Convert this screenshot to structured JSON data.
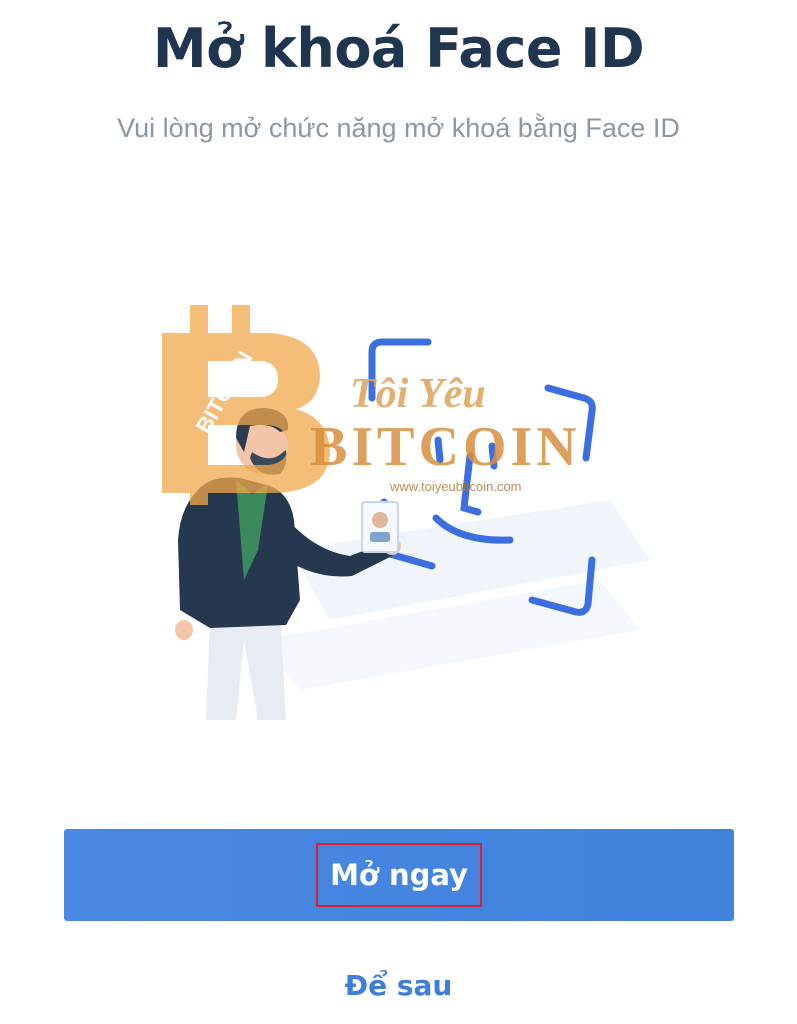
{
  "header": {
    "title": "Mở khoá Face ID",
    "subtitle": "Vui lòng mở chức năng mở khoá bằng Face ID"
  },
  "watermark": {
    "logo_text": "BITCOIN",
    "brand_line": "Tôi Yêu",
    "brand_big": "BITCOIN",
    "url": "www.toiyeubitcoin.com",
    "color": "#f2a94b"
  },
  "actions": {
    "primary_label": "Mở ngay",
    "secondary_label": "Để sau",
    "accent": "#3f82dd"
  }
}
